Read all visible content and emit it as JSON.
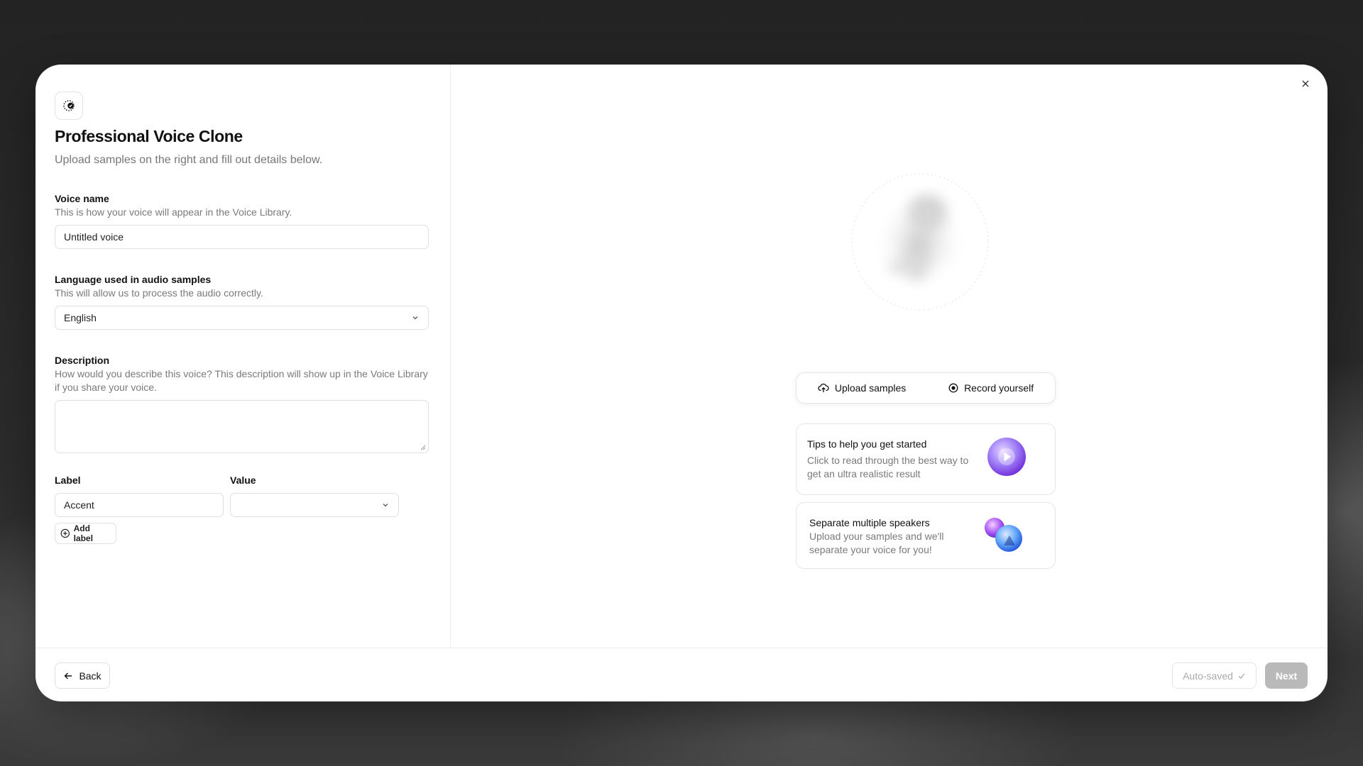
{
  "dialog": {
    "title": "Professional Voice Clone",
    "subtitle": "Upload samples on the right and fill out details below."
  },
  "form": {
    "voice_name": {
      "label": "Voice name",
      "help": "This is how your voice will appear in the Voice Library.",
      "value": "Untitled voice"
    },
    "language": {
      "label": "Language used in audio samples",
      "help": "This will allow us to process the audio correctly.",
      "value": "English"
    },
    "description": {
      "label": "Description",
      "help": "How would you describe this voice? This description will show up in the Voice Library if you share your voice.",
      "value": ""
    },
    "labels": {
      "label_header": "Label",
      "value_header": "Value",
      "label_value": "Accent",
      "value_value": "",
      "add_label": "Add label"
    }
  },
  "upload": {
    "tabs": [
      {
        "label": "Upload samples",
        "icon": "cloud-upload-icon"
      },
      {
        "label": "Record yourself",
        "icon": "record-icon"
      }
    ],
    "cards": [
      {
        "title": "Tips to help you get started",
        "text": "Click to read through the best way to get an ultra realistic result"
      },
      {
        "title": "Separate multiple speakers",
        "text": "Upload your samples and we'll separate your voice for you!"
      }
    ]
  },
  "footer": {
    "back": "Back",
    "autosaved": "Auto-saved",
    "next": "Next"
  },
  "colors": {
    "accent_purple": "#8b5cf6",
    "accent_blue": "#3b82f6",
    "next_disabled": "#b9b9b9"
  }
}
